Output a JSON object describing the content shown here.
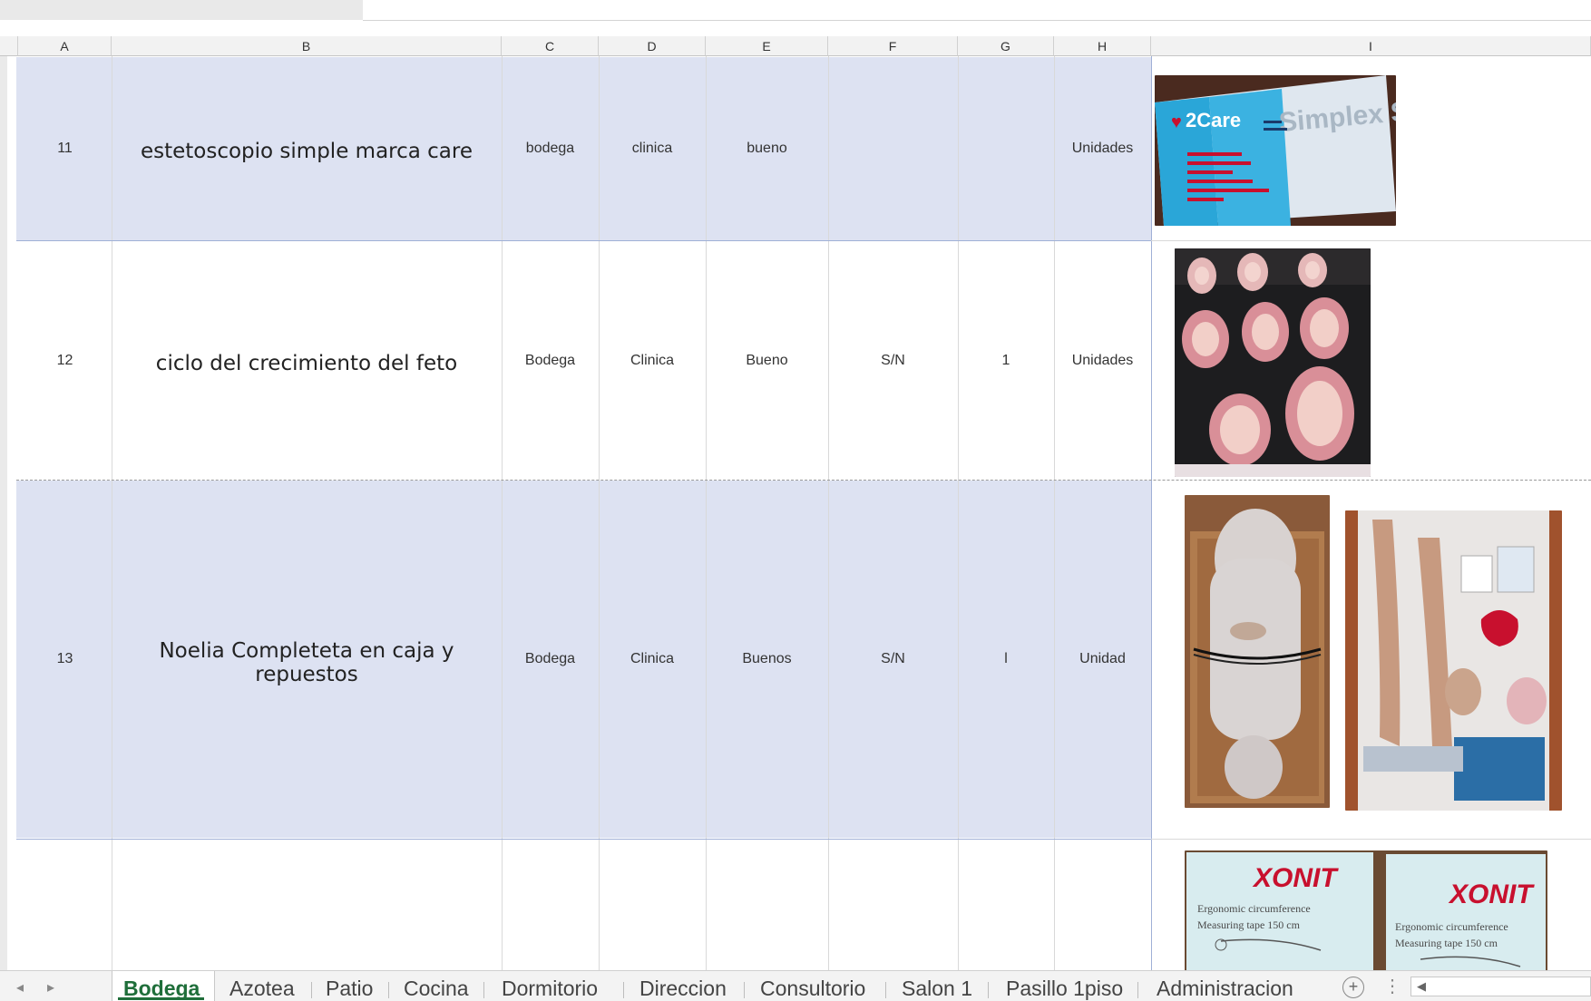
{
  "columns": [
    "A",
    "B",
    "C",
    "D",
    "E",
    "F",
    "G",
    "H",
    "I"
  ],
  "rows": [
    {
      "a": "11",
      "b": "estetoscopio simple marca care",
      "c": "bodega",
      "d": "clinica",
      "e": "bueno",
      "f": "",
      "g": "",
      "h": "Unidades"
    },
    {
      "a": "12",
      "b": "ciclo del crecimiento del feto",
      "c": "Bodega",
      "d": "Clinica",
      "e": "Bueno",
      "f": "S/N",
      "g": "1",
      "h": "Unidades"
    },
    {
      "a": "13",
      "b": "Noelia Completeta en caja y repuestos",
      "c": "Bodega",
      "d": "Clinica",
      "e": "Buenos",
      "f": "S/N",
      "g": "l",
      "h": "Unidad"
    }
  ],
  "photos": {
    "stethoscope_box": {
      "brand": "2Care",
      "product": "Simplex Stethoscope"
    },
    "tape_box_1": {
      "brand": "XONIT",
      "line1": "Ergonomic circumference",
      "line2": "Measuring tape 150 cm"
    },
    "tape_box_2": {
      "brand": "XONIT",
      "line1": "Ergonomic circumference",
      "line2": "Measuring tape 150 cm"
    }
  },
  "sheet_tabs": [
    "Bodega",
    "Azotea",
    "Patio",
    "Cocina",
    "Dormitorio",
    "Direccion",
    "Consultorio",
    "Salon 1",
    "Pasillo 1piso",
    "Administracion"
  ],
  "active_tab": "Bodega",
  "colors": {
    "row_highlight": "#dde2f2",
    "active_tab": "#1f6e3a",
    "grid": "#d9d9d9"
  }
}
